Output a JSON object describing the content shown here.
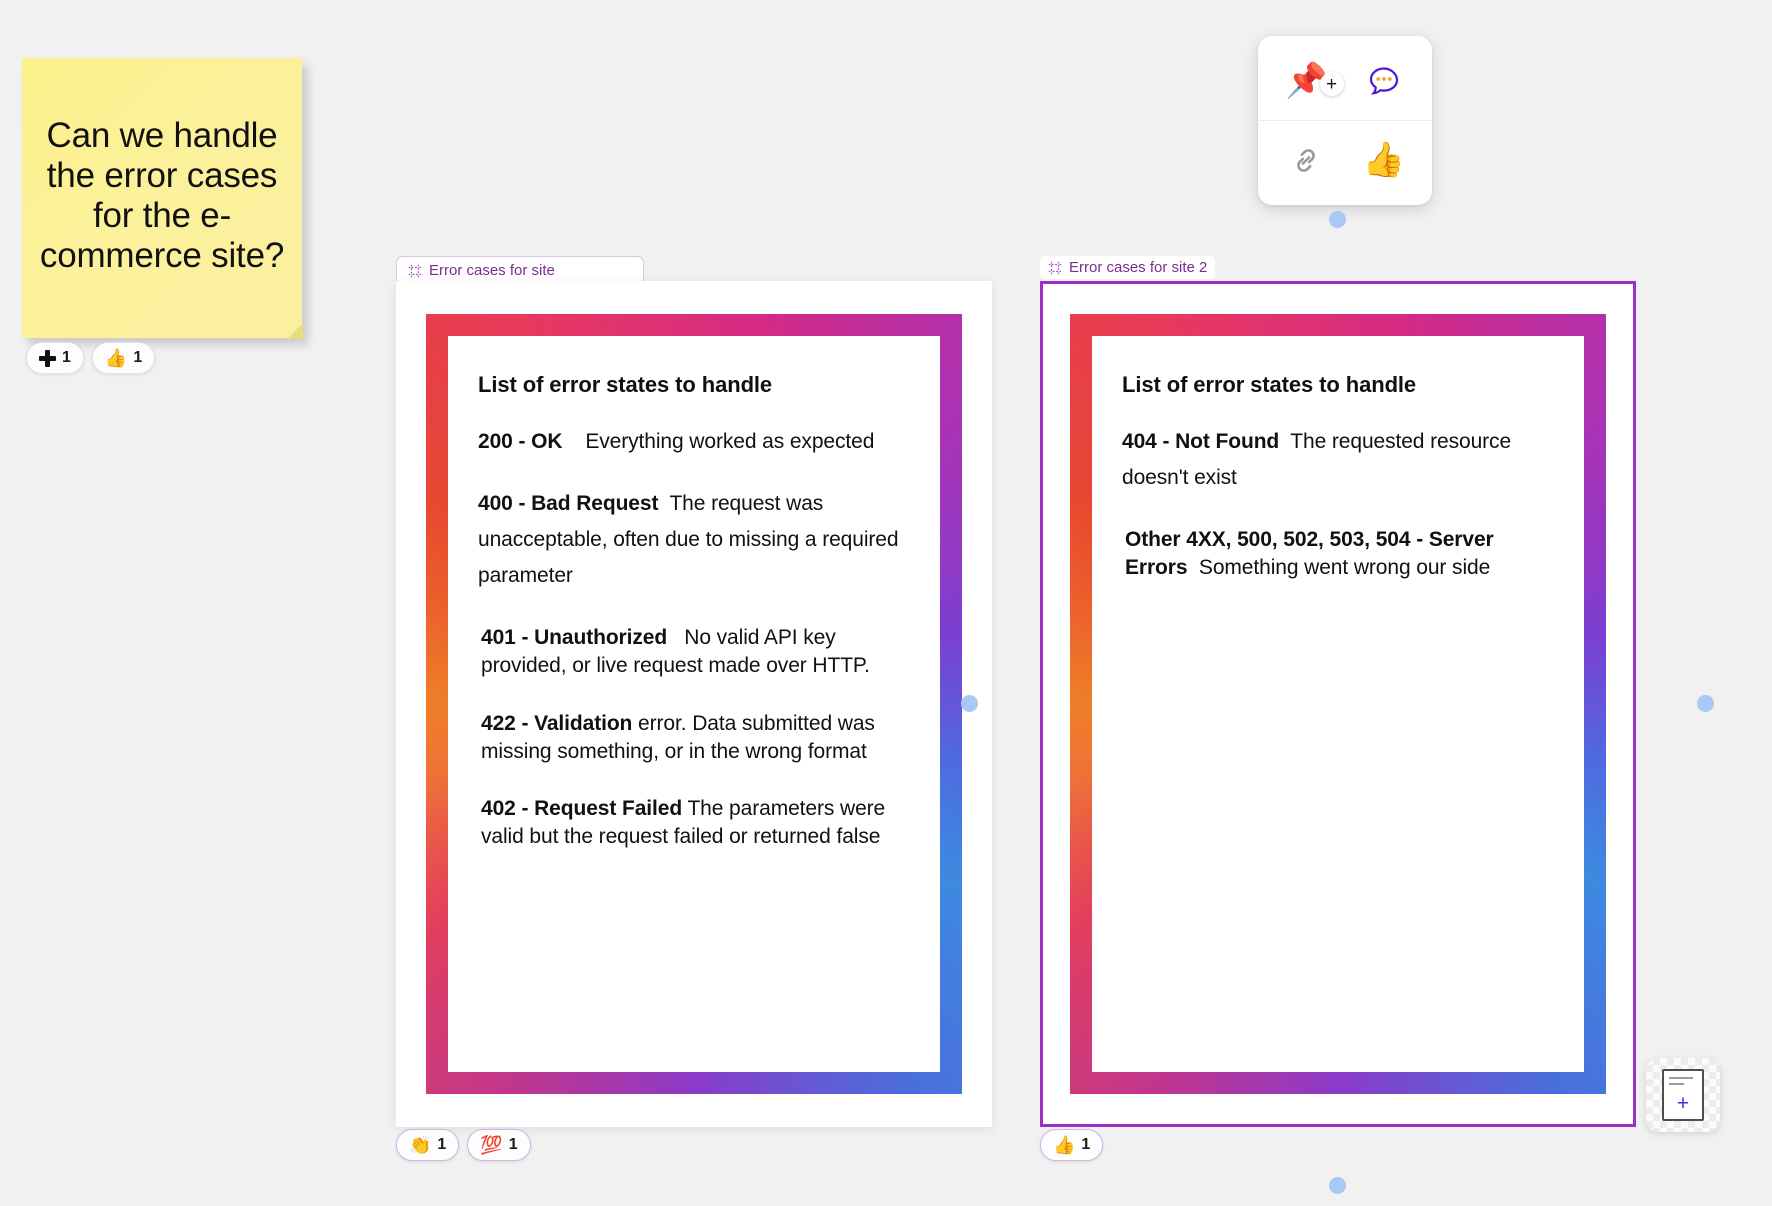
{
  "canvas": {
    "background_color": "#f1f1f1",
    "accent_purple": "#9b30c9",
    "handle_color": "#a8c9f5"
  },
  "sticky_note": {
    "text": "Can we handle the error cases for the e-commerce site?",
    "color": "#fbf19b",
    "reactions": [
      {
        "icon": "plus-icon",
        "emoji": "+",
        "count": "1"
      },
      {
        "icon": "thumbs-up-icon",
        "emoji": "👍",
        "count": "1"
      }
    ]
  },
  "toolbar": {
    "buttons": [
      {
        "name": "add-pin-button",
        "icon": "pushpin-add-icon",
        "emoji": "📌",
        "badge": "+"
      },
      {
        "name": "comment-button",
        "icon": "comment-bubble-icon"
      },
      {
        "name": "copy-link-button",
        "icon": "link-icon"
      },
      {
        "name": "thumbs-up-button",
        "icon": "thumbs-up-icon",
        "emoji": "👍"
      }
    ]
  },
  "frames": [
    {
      "id": "frame-1",
      "label": "Error cases for site",
      "label_icon": "frame-icon",
      "selected": false,
      "document": {
        "title": "List of error states to handle",
        "entries": [
          {
            "code": "200 - OK",
            "desc": "Everything worked as expected"
          },
          {
            "code": "400 - Bad Request",
            "desc": "The request was unacceptable, often due to missing a required parameter"
          },
          {
            "code": "401 - Unauthorized",
            "desc": "No valid API key provided, or live request made over HTTP."
          },
          {
            "code": "422 - Validation",
            "desc": "error. Data submitted was missing something, or in the wrong format"
          },
          {
            "code": "402 - Request Failed",
            "desc": "The parameters were valid but the request failed or returned false"
          }
        ]
      },
      "reactions": [
        {
          "icon": "clapping-hands-icon",
          "emoji": "👏",
          "count": "1"
        },
        {
          "icon": "hundred-points-icon",
          "emoji": "💯",
          "count": "1"
        }
      ]
    },
    {
      "id": "frame-2",
      "label": "Error cases for site 2",
      "label_icon": "frame-icon",
      "selected": true,
      "document": {
        "title": "List of error states to handle",
        "entries": [
          {
            "code": "404 - Not Found",
            "desc": "The requested resource doesn't exist"
          },
          {
            "code": "Other 4XX, 500, 502, 503, 504 - Server Errors",
            "desc": "Something went wrong our side"
          }
        ]
      },
      "reactions": [
        {
          "icon": "thumbs-up-icon",
          "emoji": "👍",
          "count": "1"
        }
      ]
    }
  ],
  "add_page_widget": {
    "name": "add-page-button",
    "icon": "add-document-icon",
    "plus": "+"
  }
}
